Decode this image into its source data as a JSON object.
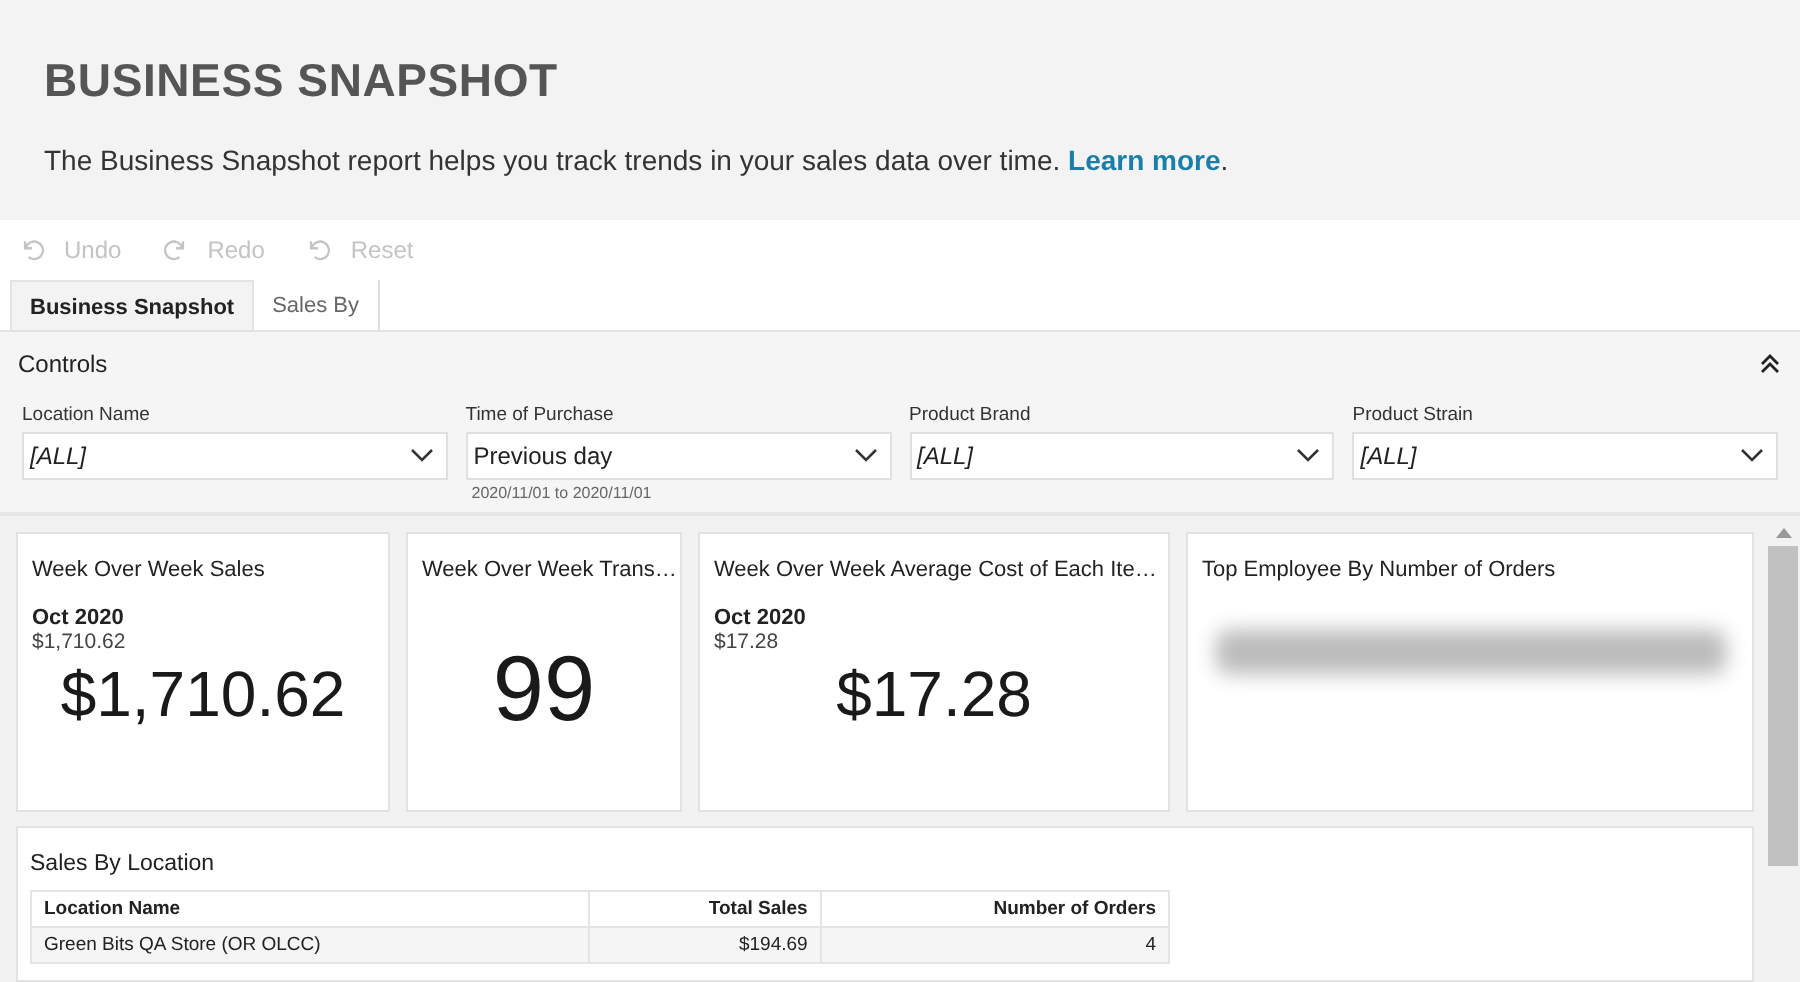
{
  "header": {
    "title": "BUSINESS SNAPSHOT",
    "description": "The Business Snapshot report helps you track trends in your sales data over time. ",
    "link": "Learn more",
    "after_link": "."
  },
  "toolbar": [
    {
      "label": "Undo",
      "kind": "undo",
      "disabled": true
    },
    {
      "label": "Redo",
      "kind": "redo",
      "disabled": true
    },
    {
      "label": "Reset",
      "kind": "reset",
      "disabled": true
    }
  ],
  "tabs": [
    {
      "label": "Business Snapshot",
      "selected": true
    },
    {
      "label": "Sales By",
      "selected": false
    }
  ],
  "controls": {
    "title": "Controls",
    "expanded": true,
    "filters": [
      {
        "label": "Location Name",
        "value": "[ALL]",
        "kind": "all"
      },
      {
        "label": "Time of Purchase",
        "value": "Previous day",
        "kind": "value",
        "hint": "2020/11/01 to 2020/11/01"
      },
      {
        "label": "Product Brand",
        "value": "[ALL]",
        "kind": "all"
      },
      {
        "label": "Product Strain",
        "value": "[ALL]",
        "kind": "all"
      }
    ]
  },
  "cards": [
    {
      "title": "Week Over Week Sales",
      "period": "Oct 2020",
      "sub_value": "$1,710.62",
      "value": "$1,710.62",
      "kind": "kpi"
    },
    {
      "title": "Week Over Week Trans…",
      "value": "99",
      "kind": "kpi"
    },
    {
      "title": "Week Over Week Average Cost of Each Ite…",
      "period": "Oct 2020",
      "sub_value": "$17.28",
      "value": "$17.28",
      "kind": "kpi"
    },
    {
      "title": "Top Employee By Number of Orders",
      "kind": "blurred"
    }
  ],
  "sales_by_location": {
    "title": "Sales By Location",
    "columns": [
      "Location Name",
      "Total Sales",
      "Number of Orders"
    ],
    "rows": [
      [
        "Green Bits QA Store (OR OLCC)",
        "$194.69",
        "4"
      ]
    ]
  }
}
